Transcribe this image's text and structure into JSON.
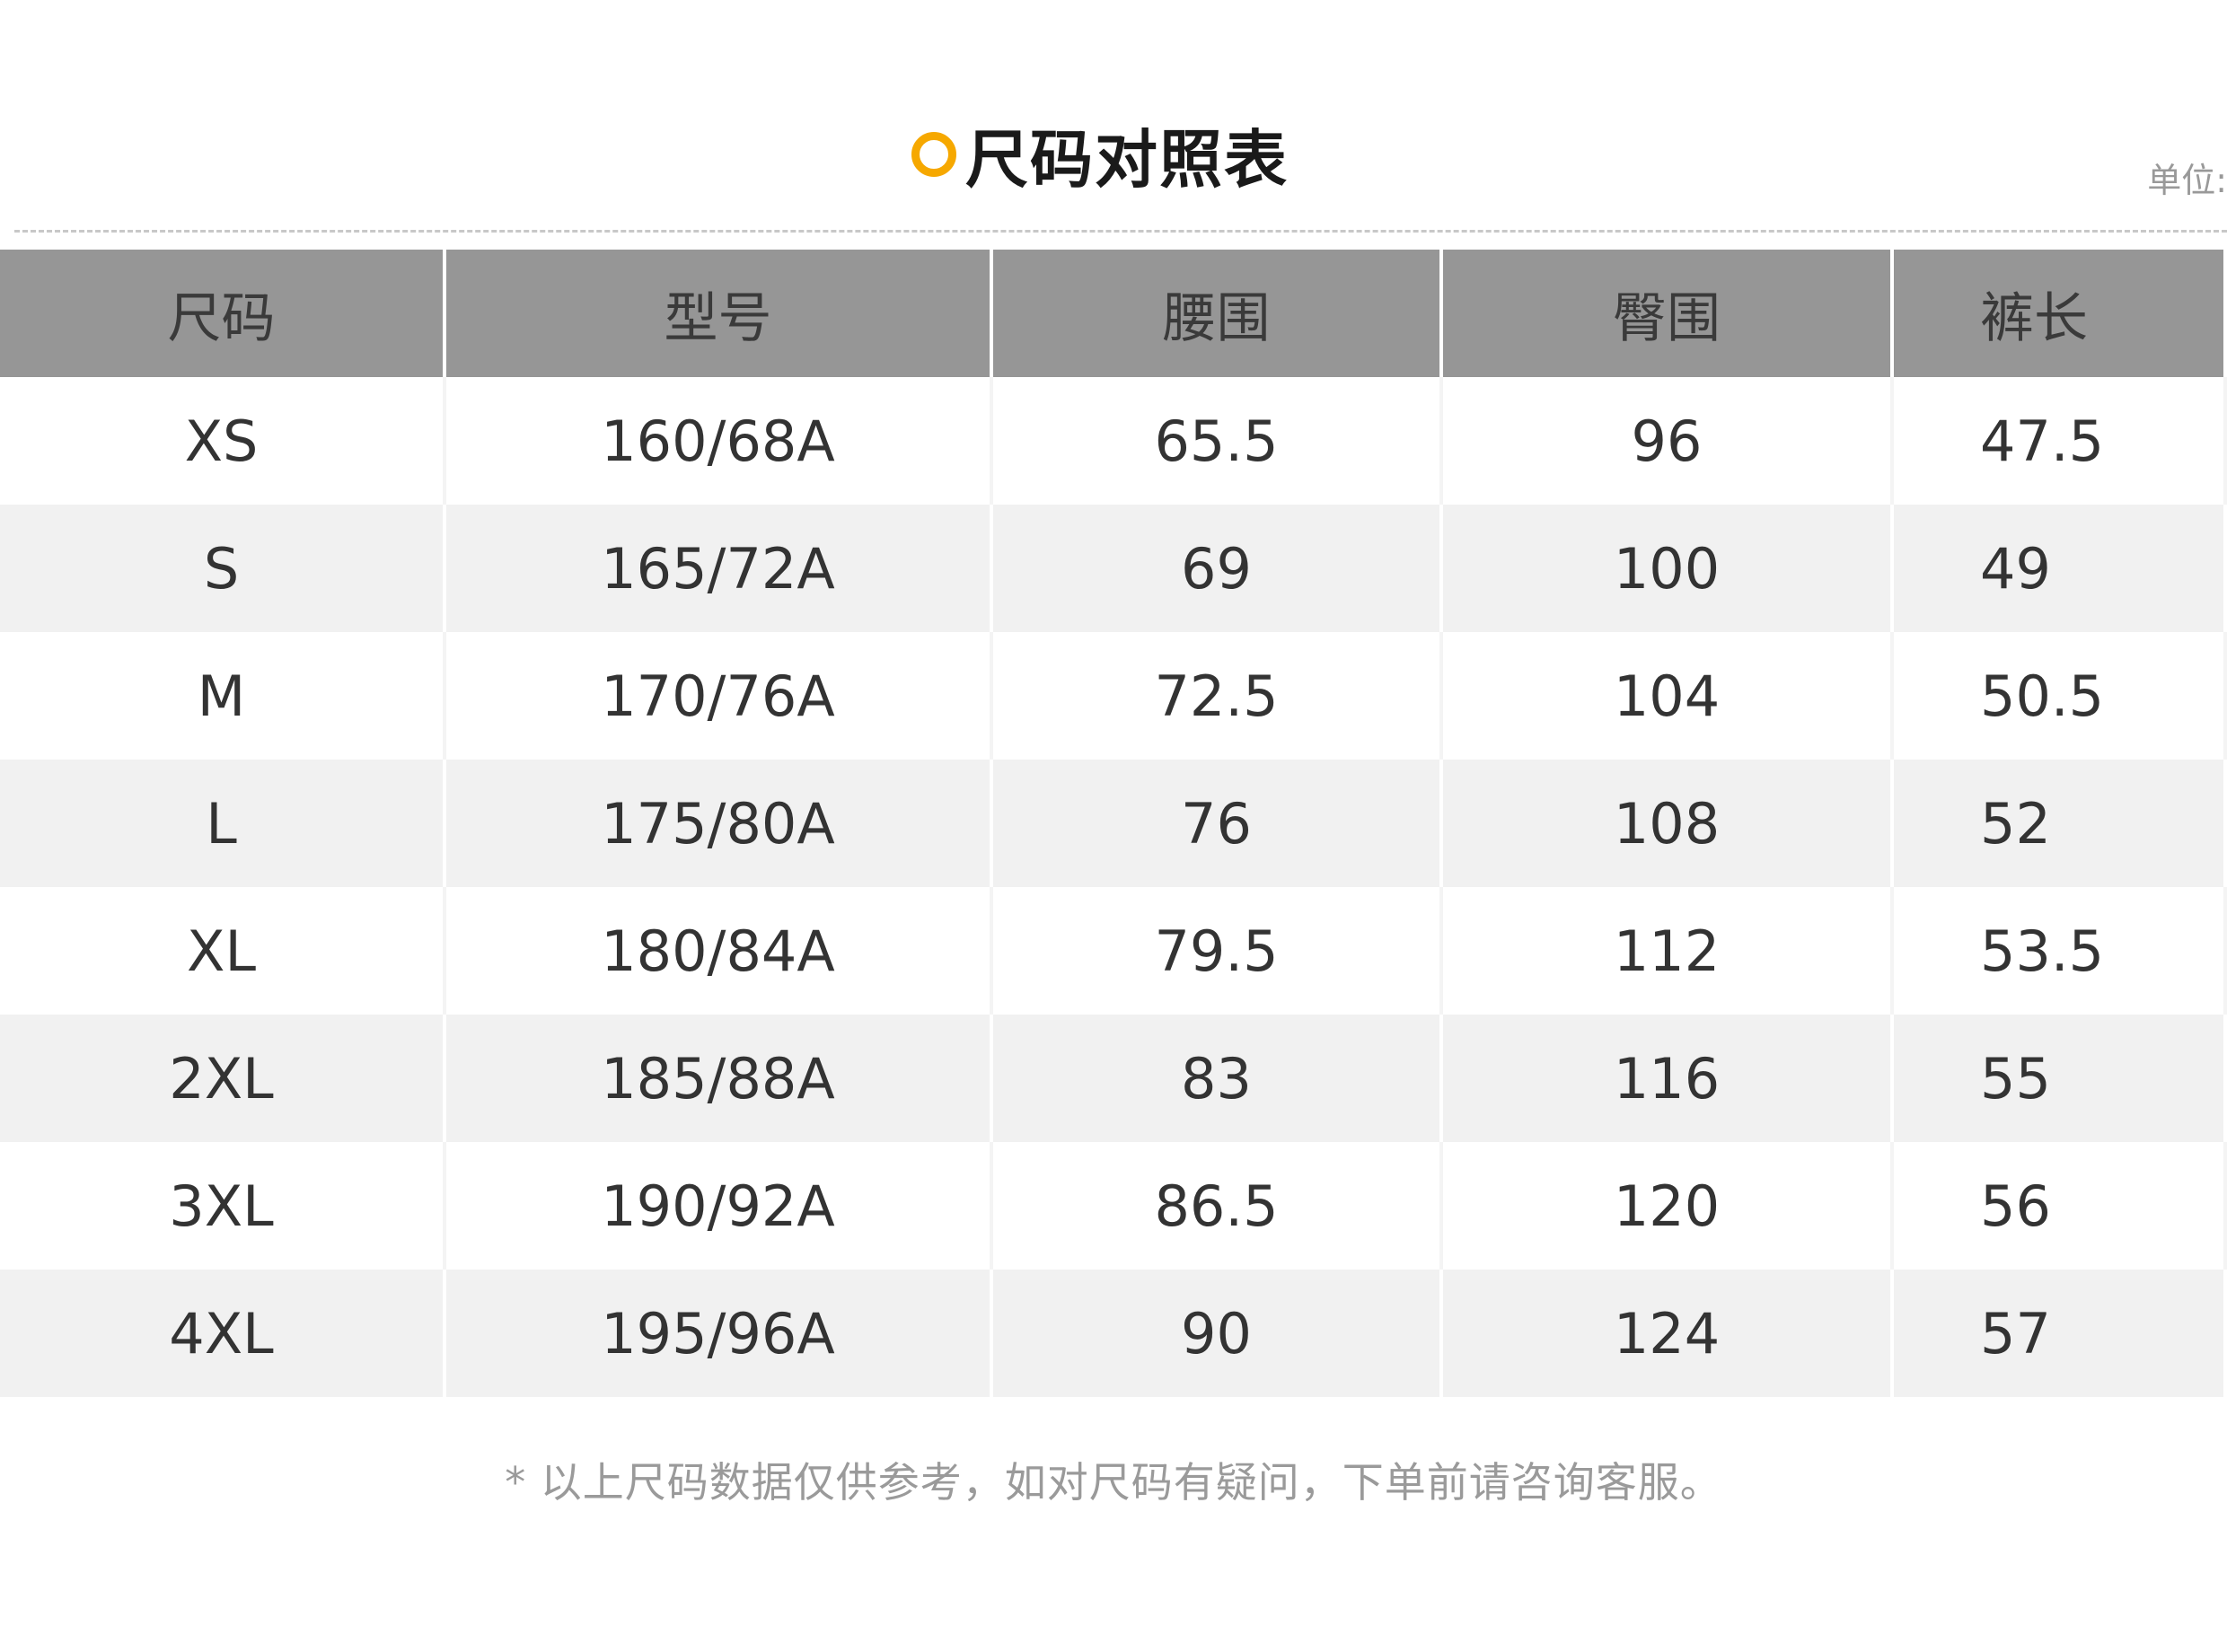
{
  "title": "尺码对照表",
  "unit_label": "单位:",
  "icon": "circle-ring-icon",
  "accent_color": "#f6a800",
  "table": {
    "headers": [
      "尺码",
      "型号",
      "腰围",
      "臀围",
      "裤长"
    ],
    "rows": [
      [
        "XS",
        "160/68A",
        "65.5",
        "96",
        "47.5"
      ],
      [
        "S",
        "165/72A",
        "69",
        "100",
        "49"
      ],
      [
        "M",
        "170/76A",
        "72.5",
        "104",
        "50.5"
      ],
      [
        "L",
        "175/80A",
        "76",
        "108",
        "52"
      ],
      [
        "XL",
        "180/84A",
        "79.5",
        "112",
        "53.5"
      ],
      [
        "2XL",
        "185/88A",
        "83",
        "116",
        "55"
      ],
      [
        "3XL",
        "190/92A",
        "86.5",
        "120",
        "56"
      ],
      [
        "4XL",
        "195/96A",
        "90",
        "124",
        "57"
      ]
    ]
  },
  "note": "* 以上尺码数据仅供参考，如对尺码有疑问，下单前请咨询客服。"
}
